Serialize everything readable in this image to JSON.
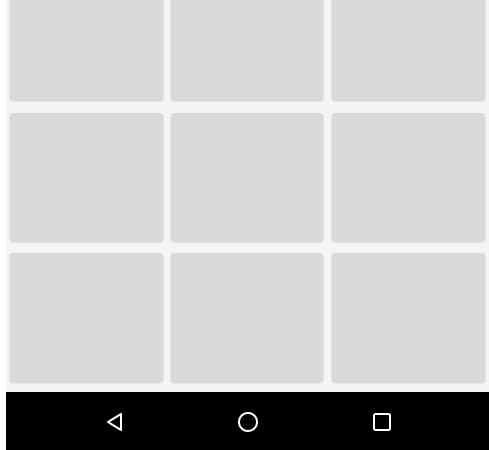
{
  "grid": {
    "rows": 3,
    "columns": 3,
    "tile_color": "#d9d9d8",
    "background_color": "#f5f5f5"
  },
  "navbar": {
    "background_color": "#000000",
    "icon_color": "#ffffff",
    "buttons": [
      {
        "name": "back",
        "icon": "triangle-back-icon"
      },
      {
        "name": "home",
        "icon": "circle-home-icon"
      },
      {
        "name": "recents",
        "icon": "square-recents-icon"
      }
    ]
  }
}
